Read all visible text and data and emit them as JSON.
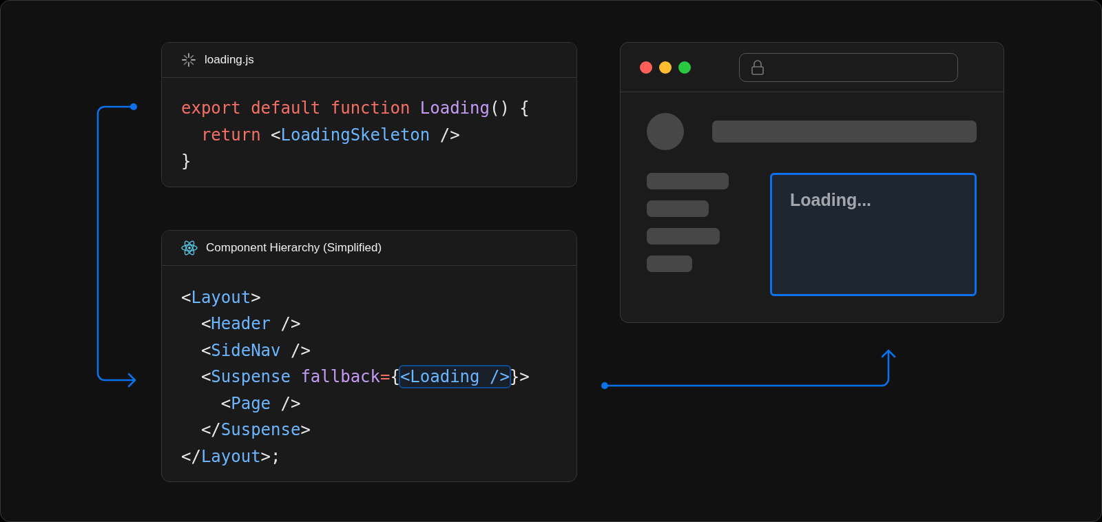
{
  "cards": [
    {
      "kind": "spinner",
      "title": "loading.js",
      "lines": [
        [
          {
            "text": "export default function ",
            "kind": "keyword"
          },
          {
            "text": "Loading",
            "kind": "func"
          },
          {
            "text": "() {",
            "kind": "plain"
          }
        ],
        [
          {
            "text": "  return ",
            "kind": "keyword"
          },
          {
            "text": "<",
            "kind": "plain"
          },
          {
            "text": "LoadingSkeleton",
            "kind": "tag"
          },
          {
            "text": " />",
            "kind": "plain"
          }
        ],
        [
          {
            "text": "}",
            "kind": "plain"
          }
        ]
      ]
    },
    {
      "kind": "atom",
      "title": "Component Hierarchy (Simplified)",
      "lines": [
        [
          {
            "text": "<",
            "kind": "plain"
          },
          {
            "text": "Layout",
            "kind": "tag"
          },
          {
            "text": ">",
            "kind": "plain"
          }
        ],
        [
          {
            "text": "  <",
            "kind": "plain"
          },
          {
            "text": "Header",
            "kind": "tag"
          },
          {
            "text": " />",
            "kind": "plain"
          }
        ],
        [
          {
            "text": "  <",
            "kind": "plain"
          },
          {
            "text": "SideNav",
            "kind": "tag"
          },
          {
            "text": " />",
            "kind": "plain"
          }
        ],
        [
          {
            "text": "  <",
            "kind": "plain"
          },
          {
            "text": "Suspense ",
            "kind": "tag"
          },
          {
            "text": "fallback",
            "kind": "func"
          },
          {
            "text": "=",
            "kind": "keyword"
          },
          {
            "text": "{",
            "kind": "plain"
          },
          {
            "text": "<Loading />",
            "kind": "framed"
          },
          {
            "text": "}>",
            "kind": "plain"
          }
        ],
        [
          {
            "text": "    <",
            "kind": "plain"
          },
          {
            "text": "Page",
            "kind": "tag"
          },
          {
            "text": " />",
            "kind": "plain"
          }
        ],
        [
          {
            "text": "  </",
            "kind": "plain"
          },
          {
            "text": "Suspense",
            "kind": "tag"
          },
          {
            "text": ">",
            "kind": "plain"
          }
        ],
        [
          {
            "text": "</",
            "kind": "plain"
          },
          {
            "text": "Layout",
            "kind": "tag"
          },
          {
            "text": ">;",
            "kind": "plain"
          }
        ]
      ]
    }
  ],
  "browser": {
    "loading_text": "Loading..."
  }
}
